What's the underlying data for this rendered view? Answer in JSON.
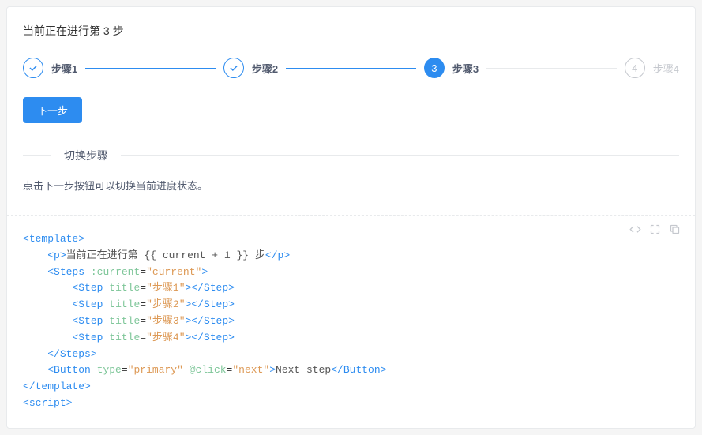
{
  "header": {
    "current_text": "当前正在进行第 3 步"
  },
  "steps": {
    "items": [
      {
        "label": "步骤1",
        "state": "done"
      },
      {
        "label": "步骤2",
        "state": "done"
      },
      {
        "label": "步骤3",
        "state": "active",
        "num": "3"
      },
      {
        "label": "步骤4",
        "state": "wait",
        "num": "4"
      }
    ]
  },
  "actions": {
    "next_label": "下一步"
  },
  "section": {
    "title": "切换步骤",
    "desc": "点击下一步按钮可以切换当前进度状态。"
  },
  "code": {
    "l1_tag": "template",
    "l2_tag": "p",
    "l2_txt_a": "当前正在进行第 ",
    "l2_txt_b": " 步",
    "l2_expr": "{{ current + 1 }}",
    "l3_tag": "Steps",
    "l3_attr": ":current",
    "l3_val": "current",
    "l4_tag": "Step",
    "l4_attr": "title",
    "l4_val": "步骤1",
    "l5_tag": "Step",
    "l5_attr": "title",
    "l5_val": "步骤2",
    "l6_tag": "Step",
    "l6_attr": "title",
    "l6_val": "步骤3",
    "l7_tag": "Step",
    "l7_attr": "title",
    "l7_val": "步骤4",
    "l8_tag": "Steps",
    "l9_tag": "Button",
    "l9_attr1": "type",
    "l9_val1": "primary",
    "l9_attr2": "@click",
    "l9_val2": "next",
    "l9_txt": "Next step",
    "l10_tag": "template",
    "l11_tag": "script"
  },
  "colors": {
    "primary": "#2d8cf0",
    "border": "#e8eaec",
    "text": "#515a6e",
    "muted": "#c5c8ce"
  }
}
